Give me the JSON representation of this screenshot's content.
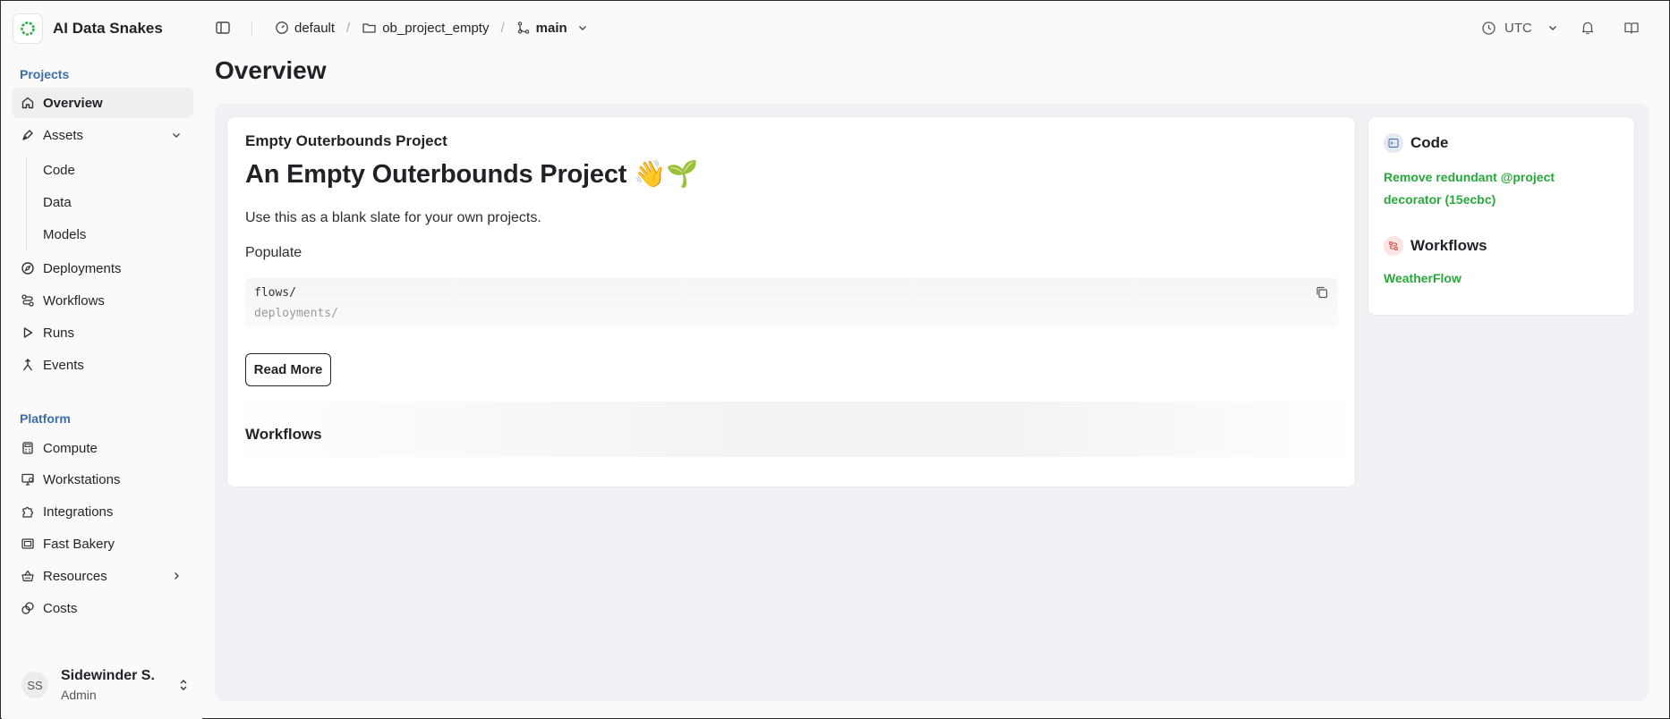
{
  "brand": {
    "name": "AI Data Snakes"
  },
  "sidebar": {
    "projects_label": "Projects",
    "platform_label": "Platform",
    "overview": "Overview",
    "assets": "Assets",
    "assets_children": [
      "Code",
      "Data",
      "Models"
    ],
    "deployments": "Deployments",
    "workflows": "Workflows",
    "runs": "Runs",
    "events": "Events",
    "compute": "Compute",
    "workstations": "Workstations",
    "integrations": "Integrations",
    "fast_bakery": "Fast Bakery",
    "resources": "Resources",
    "costs": "Costs"
  },
  "user": {
    "initials": "SS",
    "name": "Sidewinder S.",
    "role": "Admin"
  },
  "breadcrumb": {
    "workspace": "default",
    "project": "ob_project_empty",
    "branch": "main"
  },
  "topbar": {
    "timezone": "UTC"
  },
  "page": {
    "title": "Overview"
  },
  "project": {
    "label": "Empty Outerbounds Project",
    "title": "An Empty Outerbounds Project 👋🌱",
    "description": "Use this as a blank slate for your own projects.",
    "populate_label": "Populate",
    "code_lines": [
      "flows/",
      "deployments/"
    ],
    "read_more": "Read More",
    "workflows_heading": "Workflows"
  },
  "side_panel": {
    "code_heading": "Code",
    "code_commit_line1": "Remove redundant @project",
    "code_commit_line2": "decorator (15ecbc)",
    "workflows_heading": "Workflows",
    "workflow_link": "WeatherFlow"
  },
  "colors": {
    "accent_blue": "#3b6ea8",
    "link_green": "#27a83a",
    "content_bg": "#f0f1f4"
  }
}
